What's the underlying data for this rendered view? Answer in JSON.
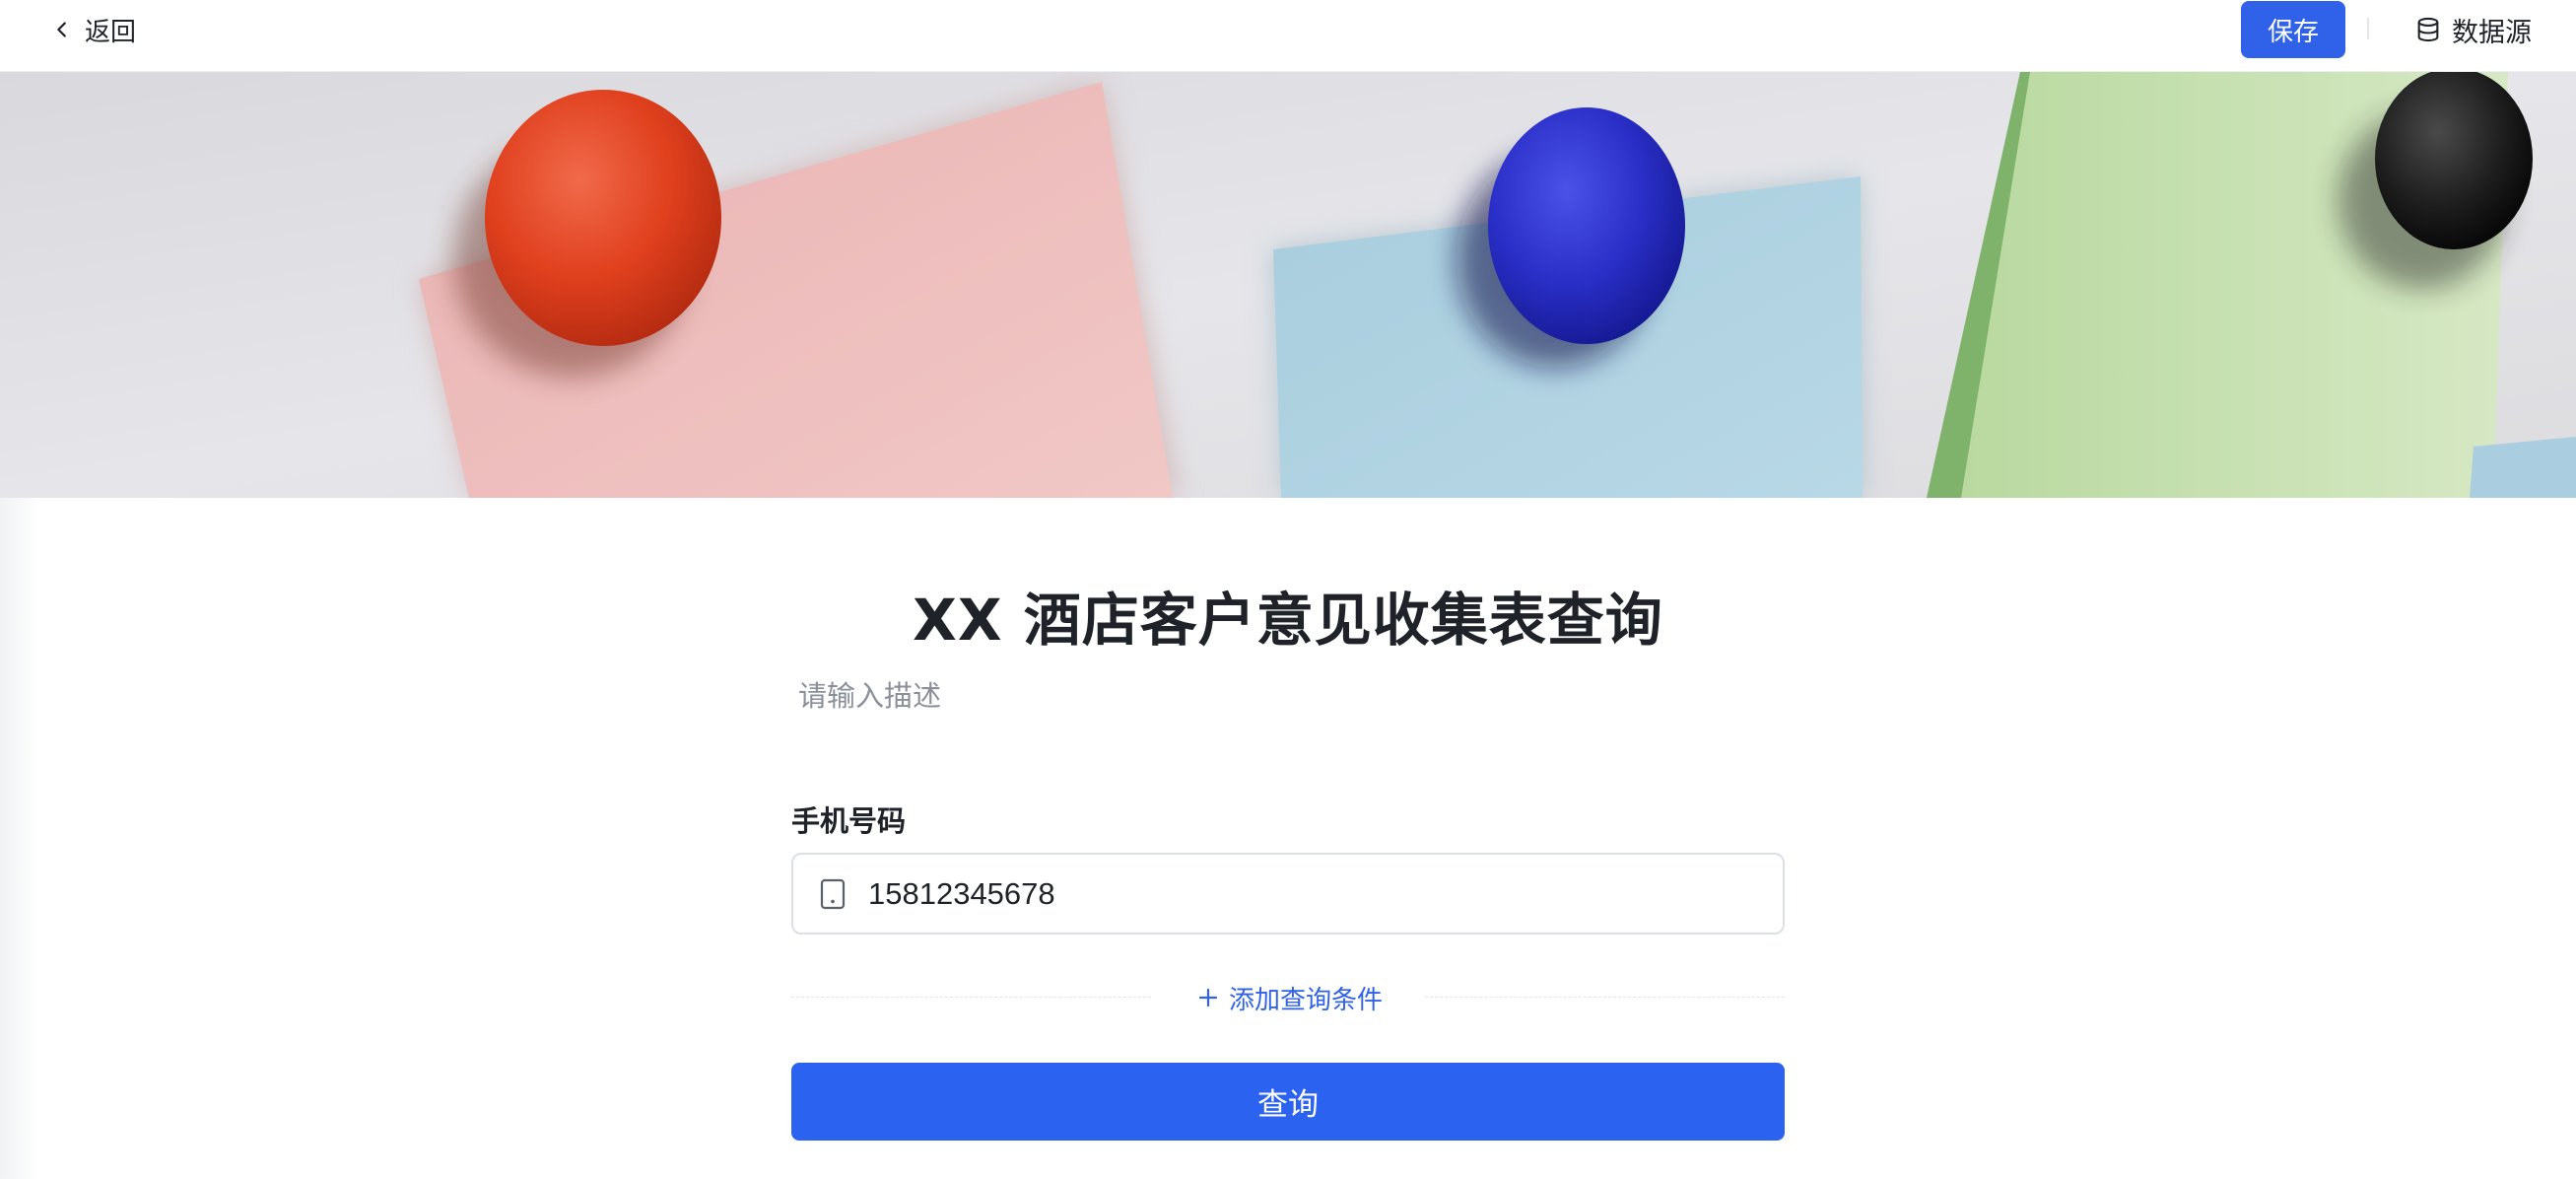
{
  "topbar": {
    "back_label": "返回",
    "save_label": "保存",
    "datasource_label": "数据源"
  },
  "form": {
    "title": "XX 酒店客户意见收集表查询",
    "description": "请输入描述",
    "fields": [
      {
        "label": "手机号码",
        "value": "15812345678",
        "icon": "mobile-phone-icon"
      }
    ],
    "add_condition_label": "添加查询条件",
    "query_label": "查询"
  },
  "colors": {
    "primary": "#2b62f0",
    "text": "#1f2329",
    "placeholder": "#8a8f99"
  },
  "icons": {
    "back": "chevron-left-icon",
    "datasource": "database-icon",
    "add": "plus-icon"
  }
}
